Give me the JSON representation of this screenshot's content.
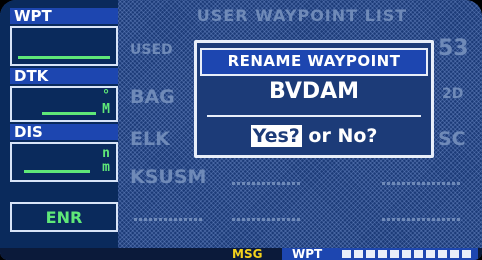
{
  "sidebar": {
    "wpt_label": "WPT",
    "dtk_label": "DTK",
    "dtk_unit": "°",
    "dtk_unit2": "M",
    "dis_label": "DIS",
    "dis_unit": "n",
    "dis_unit2": "m",
    "mode": "ENR"
  },
  "main": {
    "title": "USER WAYPOINT LIST",
    "used_label": "USED",
    "used_count": "53",
    "rows": [
      "BAG",
      "ELK",
      "KSUSM"
    ],
    "right_fragments": [
      "2D",
      "SC"
    ]
  },
  "dialog": {
    "title": "RENAME WAYPOINT",
    "waypoint_name": "BVDAM",
    "yes_label": "Yes?",
    "or_text": "or No?"
  },
  "status": {
    "msg": "MSG",
    "page_mode": "WPT"
  },
  "colors": {
    "lcd_blue": "#1c3b78",
    "accent_green": "#5fe878",
    "msg_yellow": "#f4d21c"
  }
}
